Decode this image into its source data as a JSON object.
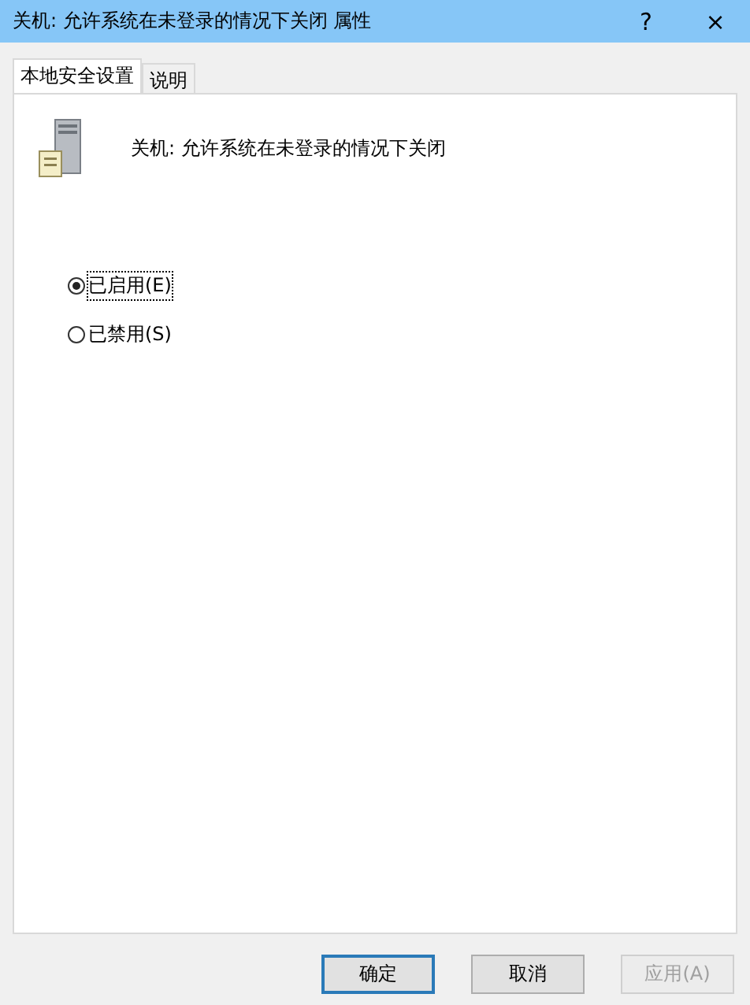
{
  "window": {
    "title": "关机: 允许系统在未登录的情况下关闭 属性",
    "help": "?",
    "close": "×"
  },
  "tabs": [
    {
      "label": "本地安全设置",
      "selected": true
    },
    {
      "label": "说明",
      "selected": false
    }
  ],
  "policy": {
    "name": "关机: 允许系统在未登录的情况下关闭"
  },
  "options": [
    {
      "label": "已启用(E)",
      "selected": true
    },
    {
      "label": "已禁用(S)",
      "selected": false
    }
  ],
  "buttons": [
    {
      "label": "确定",
      "default": true,
      "disabled": false
    },
    {
      "label": "取消",
      "default": false,
      "disabled": false
    },
    {
      "label": "应用(A)",
      "default": false,
      "disabled": true
    }
  ]
}
